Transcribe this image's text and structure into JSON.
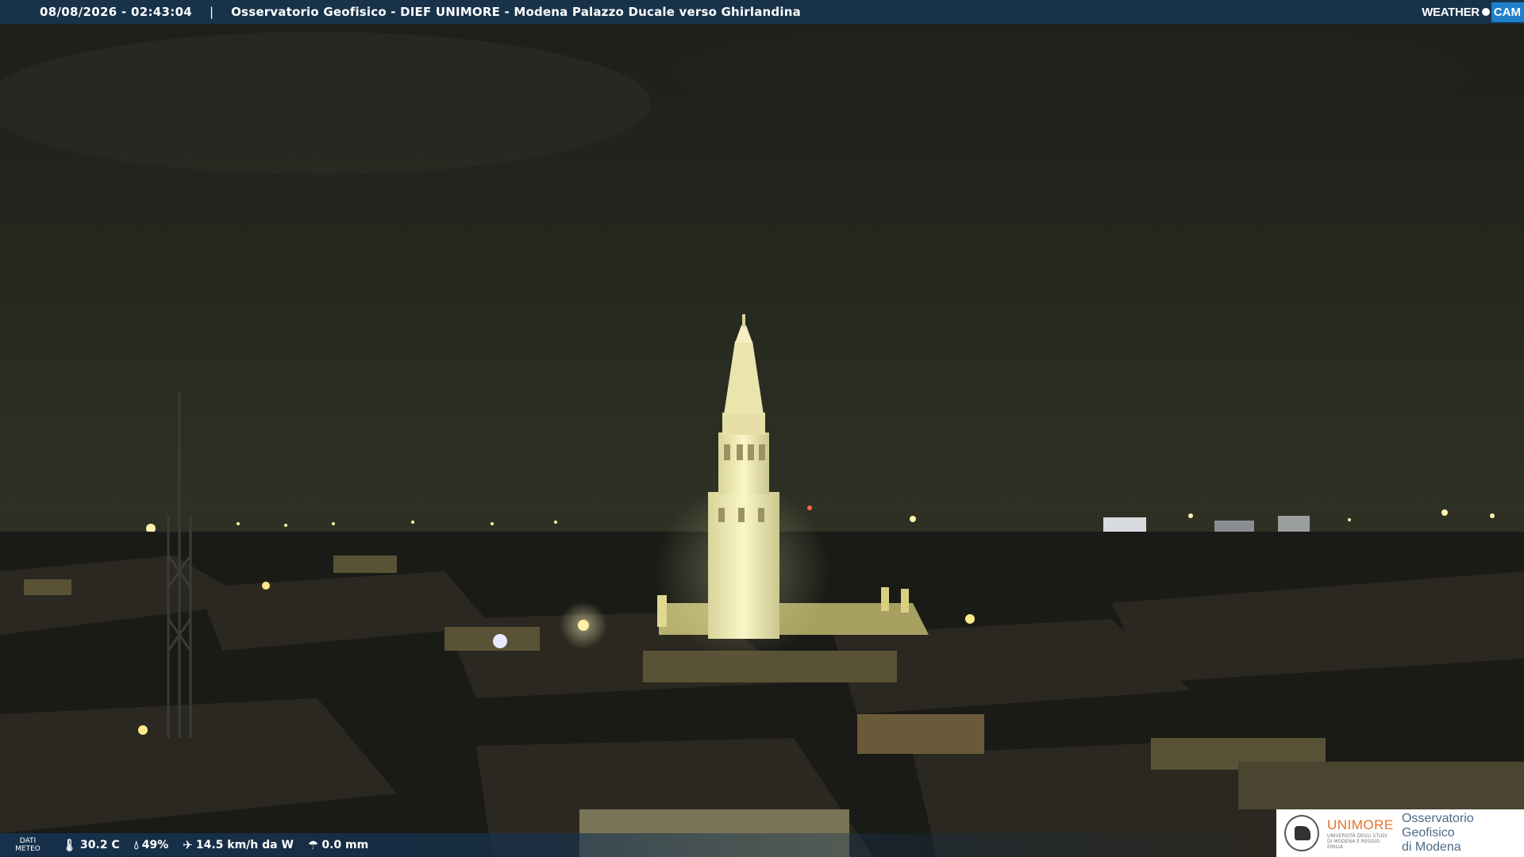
{
  "header": {
    "timestamp": "08/08/2026 - 02:43:04",
    "separator": "|",
    "camera_title": "Osservatorio Geofisico - DIEF UNIMORE - Modena Palazzo Ducale verso Ghirlandina"
  },
  "brand": {
    "weather_text": "WEATHER",
    "cam_text": "CAM"
  },
  "weather": {
    "label_line1": "DATI",
    "label_line2": "METEO",
    "temperature": "30.2 C",
    "humidity": "49%",
    "wind": "14.5 km/h da W",
    "rain": "0.0 mm"
  },
  "logo": {
    "university": "UNIMORE",
    "university_full": "UNIVERSITÀ DEGLI STUDI DI MODENA E REGGIO EMILIA",
    "observatory_line1": "Osservatorio Geofisico",
    "observatory_line2": "di Modena"
  },
  "icons": {
    "temperature": "thermometer-icon",
    "humidity": "droplet-icon",
    "wind": "wind-icon",
    "rain": "rain-gauge-icon"
  },
  "colors": {
    "bar": "#18344e",
    "cam_accent": "#1f7fc9",
    "unimore_orange": "#e8702a",
    "tower_light": "#f4efb0"
  }
}
